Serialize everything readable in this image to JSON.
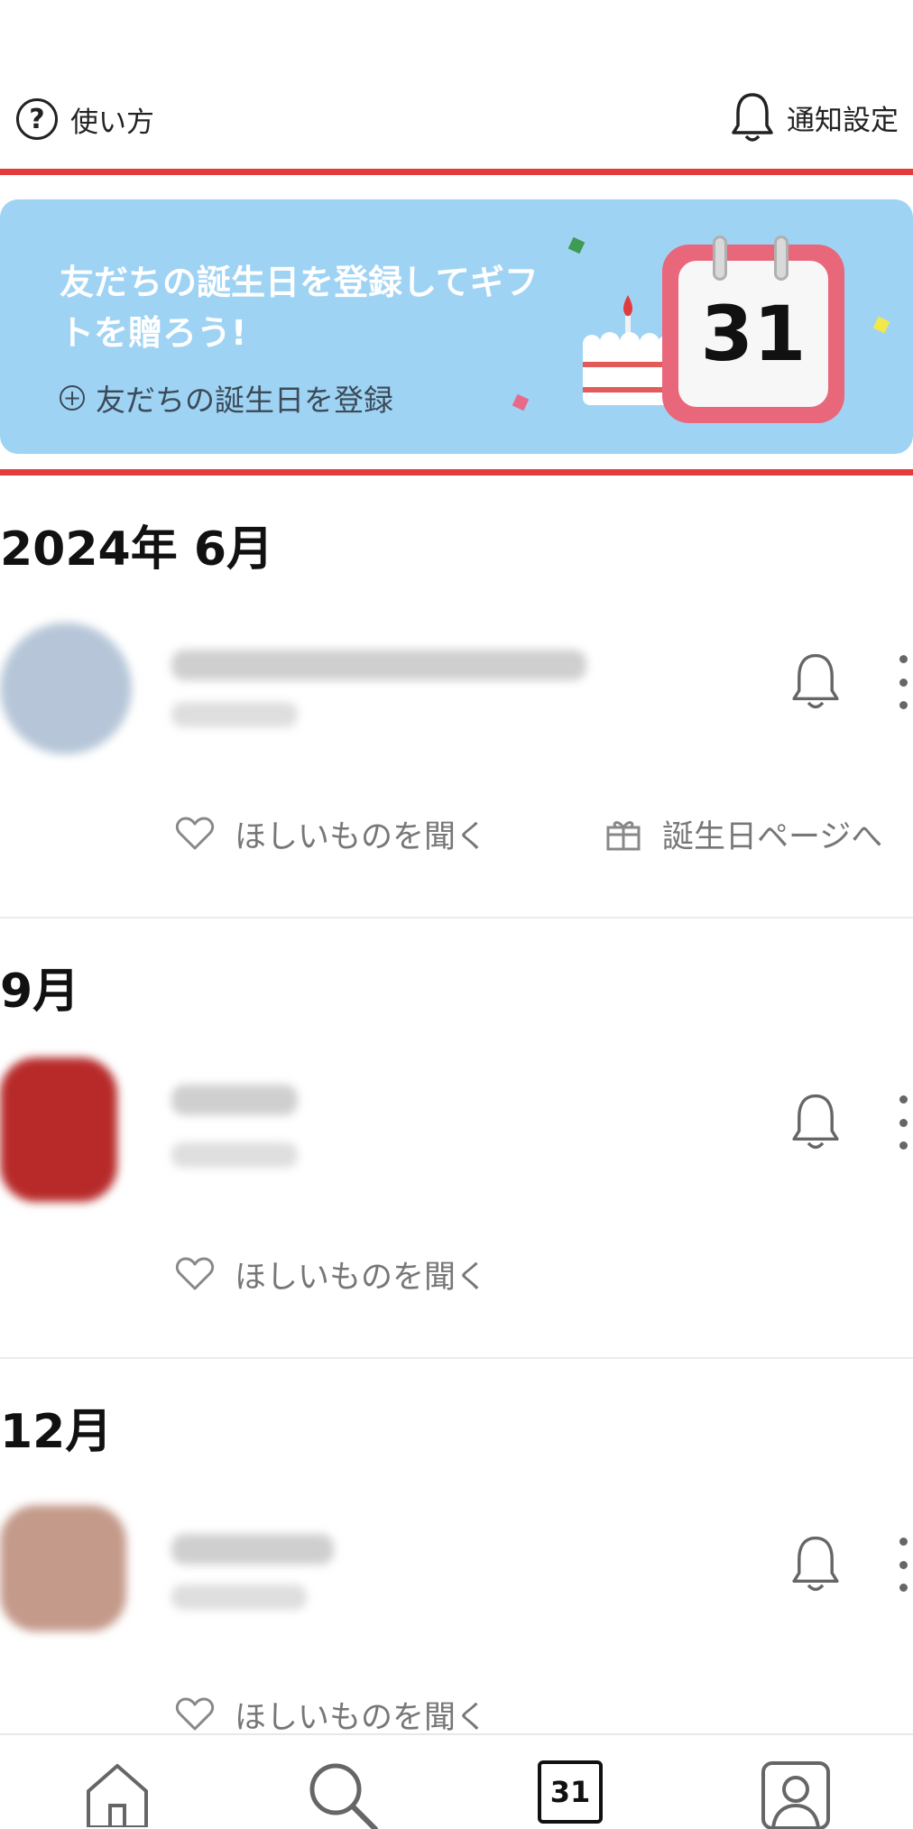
{
  "header": {
    "help_label": "使い方",
    "notification_settings_label": "通知設定"
  },
  "banner": {
    "title": "友だちの誕生日を登録してギフトを贈ろう!",
    "cta_label": "友だちの誕生日を登録",
    "calendar_number": "31"
  },
  "sections": [
    {
      "month": "2024年 6月",
      "actions": [
        "ほしいものを聞く",
        "誕生日ページへ"
      ]
    },
    {
      "month": "9月",
      "actions": [
        "ほしいものを聞く"
      ]
    },
    {
      "month": "12月",
      "actions": [
        "ほしいものを聞く"
      ]
    }
  ],
  "tabbar": {
    "items": [
      "home-icon",
      "search-icon",
      "calendar-icon",
      "profile-icon"
    ],
    "calendar_number": "31"
  },
  "colors": {
    "accent_red": "#e63b3b",
    "banner_blue": "#9fd3f4",
    "calendar_pink": "#e8677a"
  }
}
